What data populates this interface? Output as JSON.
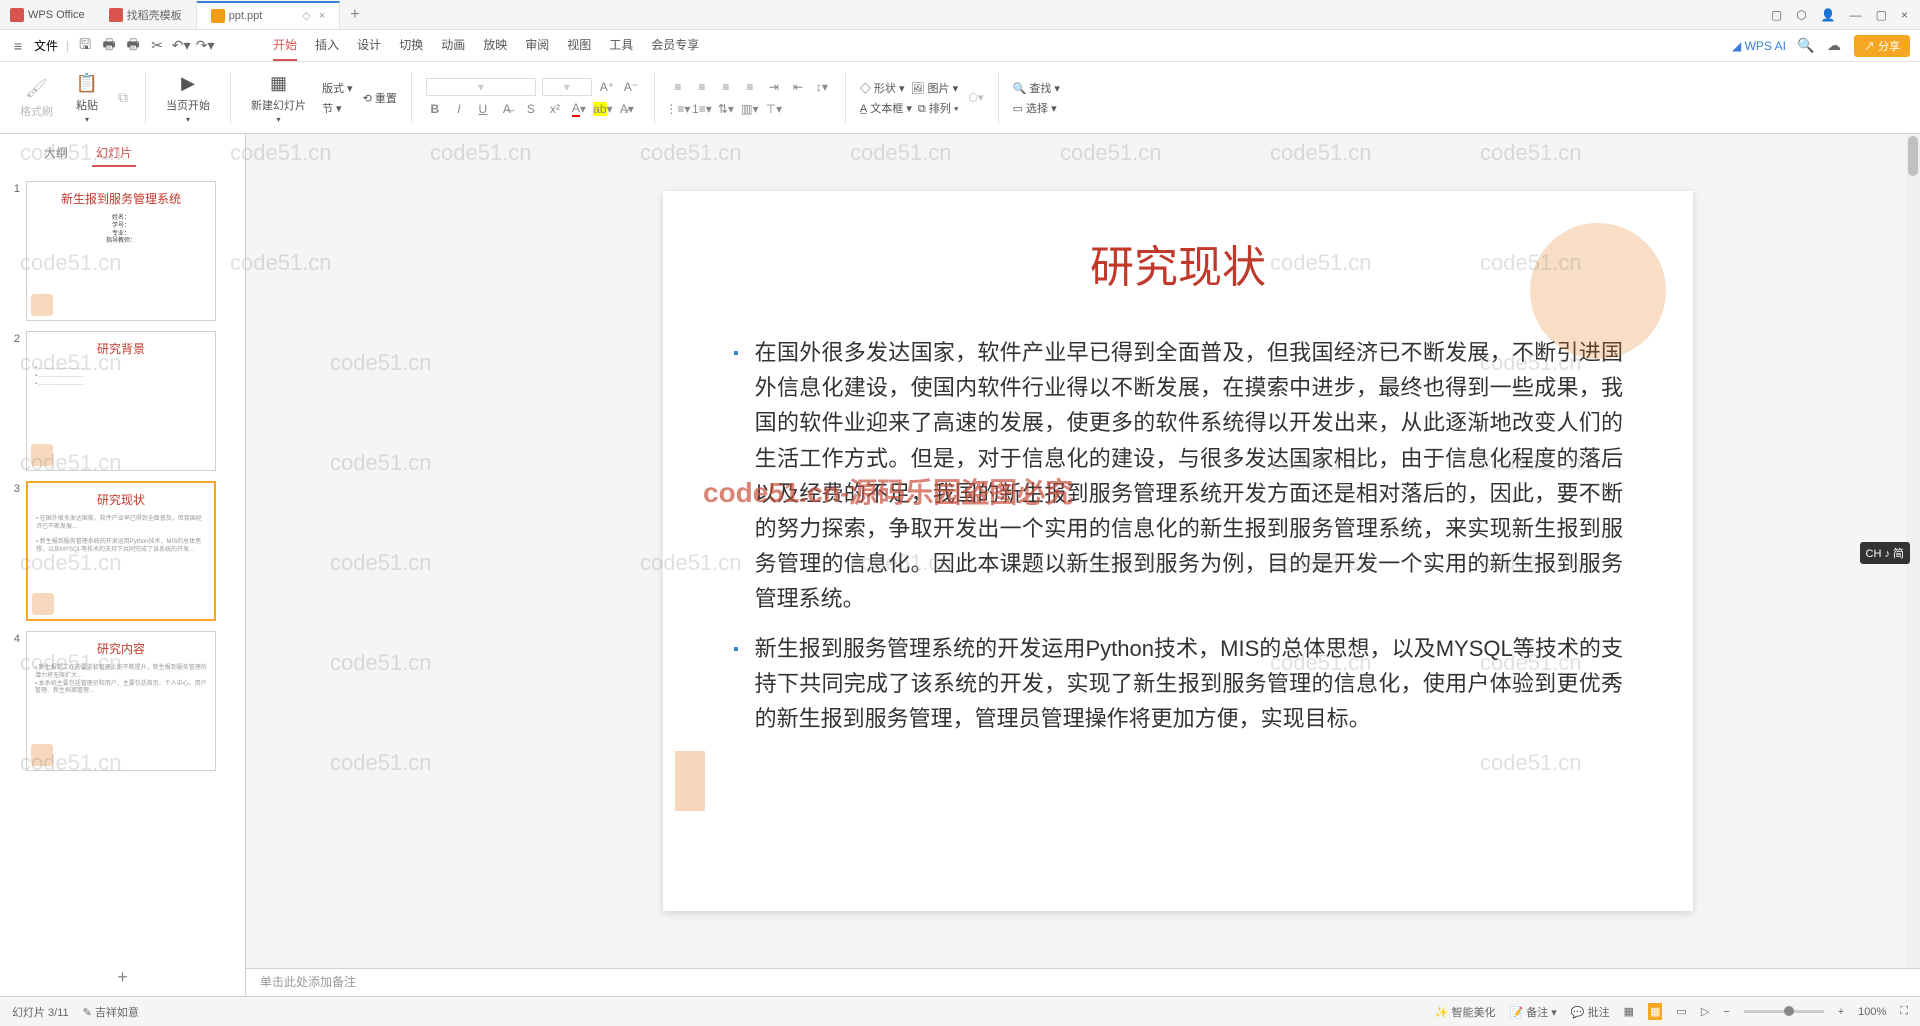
{
  "titlebar": {
    "appName": "WPS Office",
    "tabs": [
      {
        "label": "找稻壳模板",
        "iconColor": "red"
      },
      {
        "label": "ppt.ppt",
        "iconColor": "orange",
        "active": true
      }
    ]
  },
  "menu": {
    "fileLabel": "文件",
    "items": [
      "开始",
      "插入",
      "设计",
      "切换",
      "动画",
      "放映",
      "审阅",
      "视图",
      "工具",
      "会员专享"
    ],
    "activeIndex": 0,
    "wpsAi": "WPS AI",
    "share": "分享"
  },
  "ribbon": {
    "formatBrush": "格式刷",
    "paste": "粘贴",
    "currentStart": "当页开始",
    "newSlide": "新建幻灯片",
    "format": "版式",
    "section": "节",
    "reset": "重置",
    "shape": "形状",
    "picture": "图片",
    "textbox": "文本框",
    "arrange": "排列",
    "find": "查找",
    "select": "选择"
  },
  "sidePanel": {
    "tabs": [
      "大纲",
      "幻灯片"
    ],
    "activeTab": 1,
    "slides": [
      {
        "num": "1",
        "title": "新生报到服务管理系统",
        "body": "姓名：\n学号：\n专业：\n指导教师："
      },
      {
        "num": "2",
        "title": "研究背景",
        "body": ""
      },
      {
        "num": "3",
        "title": "研究现状",
        "body": "",
        "selected": true
      },
      {
        "num": "4",
        "title": "研究内容",
        "body": ""
      }
    ]
  },
  "slide": {
    "title": "研究现状",
    "bullets": [
      "在国外很多发达国家，软件产业早已得到全面普及，但我国经济已不断发展，不断引进国外信息化建设，使国内软件行业得以不断发展，在摸索中进步，最终也得到一些成果，我国的软件业迎来了高速的发展，使更多的软件系统得以开发出来，从此逐渐地改变人们的生活工作方式。但是，对于信息化的建设，与很多发达国家相比，由于信息化程度的落后以及经费的不足，我国的新生报到服务管理系统开发方面还是相对落后的，因此，要不断的努力探索，争取开发出一个实用的信息化的新生报到服务管理系统，来实现新生报到服务管理的信息化。因此本课题以新生报到服务为例，目的是开发一个实用的新生报到服务管理系统。",
      "新生报到服务管理系统的开发运用Python技术，MIS的总体思想，以及MYSQL等技术的支持下共同完成了该系统的开发，实现了新生报到服务管理的信息化，使用户体验到更优秀的新生报到服务管理，管理员管理操作将更加方便，实现目标。"
    ],
    "watermarkCenter": "code51.cn-源码乐园盗图必究"
  },
  "notes": {
    "placeholder": "单击此处添加备注"
  },
  "status": {
    "slidePos": "幻灯片 3/11",
    "author": "吉祥如意",
    "smartBeautify": "智能美化",
    "remarks": "备注",
    "comments": "批注",
    "zoom": "100%"
  },
  "ime": "CH ♪ 简",
  "watermarkRepeat": "code51.cn"
}
